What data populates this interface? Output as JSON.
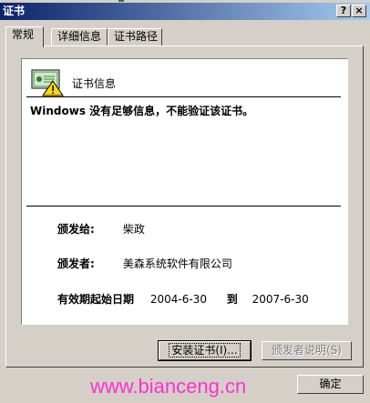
{
  "window": {
    "title": "证书",
    "help_label": "?",
    "close_label": "×"
  },
  "tabs": [
    {
      "label": "常规",
      "active": true
    },
    {
      "label": "详细信息",
      "active": false
    },
    {
      "label": "证书路径",
      "active": false
    }
  ],
  "info": {
    "title": "证书信息",
    "message": "Windows 没有足够信息，不能验证该证书。",
    "issued_to_label": "颁发给:",
    "issued_to": "柴政",
    "issued_by_label": "颁发者:",
    "issued_by": "美森系统软件有限公司",
    "valid_label": "有效期起始日期",
    "valid_from": "2004-6-30",
    "valid_to_word": "到",
    "valid_to": "2007-6-30"
  },
  "buttons": {
    "install": "安装证书(I)...",
    "issuer_statement": "颁发者说明(S)",
    "ok": "确定"
  },
  "watermark": "www.bianceng.cn",
  "colors": {
    "titlebar_start": "#0a246a",
    "titlebar_end": "#a6caf0",
    "watermark": "#ff2fd5"
  },
  "icons": {
    "certificate": "certificate-warning-icon"
  }
}
